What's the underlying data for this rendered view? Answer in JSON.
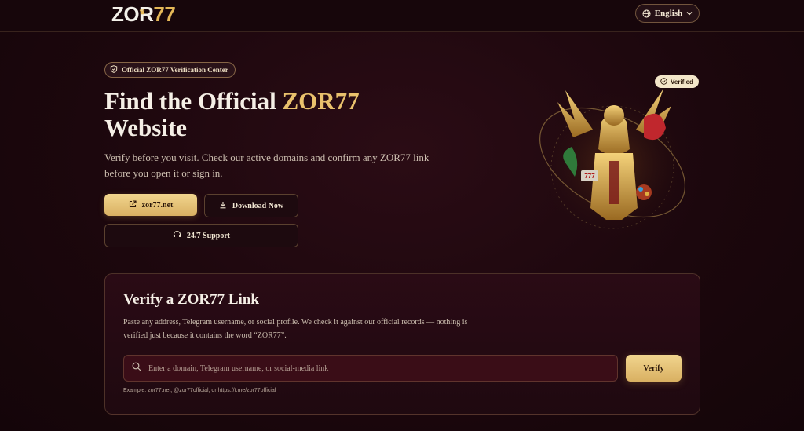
{
  "header": {
    "logo_white": "ZOR",
    "logo_gold": "77",
    "language_label": "English",
    "icons": [
      "globe-icon",
      "chevron-down-icon",
      "crown-icon"
    ]
  },
  "hero": {
    "badge_label": "Official ZOR77 Verification Center",
    "title_part1": "Find the Official ",
    "title_brand": "ZOR77",
    "title_part2": "Website",
    "subtitle": "Verify before you visit. Check our active domains and confirm any ZOR77 link before you open it or sign in.",
    "domain_button_label": "zor77.net",
    "download_button_label": "Download Now",
    "support_button_label": "24/7 Support",
    "verified_badge_label": "Verified"
  },
  "verify": {
    "title": "Verify a ZOR77 Link",
    "description": "Paste any address, Telegram username, or social profile. We check it against our official records — nothing is verified just because it contains the word “ZOR77”.",
    "input_placeholder": "Enter a domain, Telegram username, or social-media link",
    "input_value": "",
    "button_label": "Verify",
    "example_text": "Example: zor77.net, @zor77official, or https://t.me/zor77official"
  },
  "colors": {
    "background": "#1c070d",
    "accent_gold": "#e9c16c",
    "button_gold": "#d9b062",
    "text_primary": "#f5efe6",
    "text_muted": "#cdbfb0"
  }
}
